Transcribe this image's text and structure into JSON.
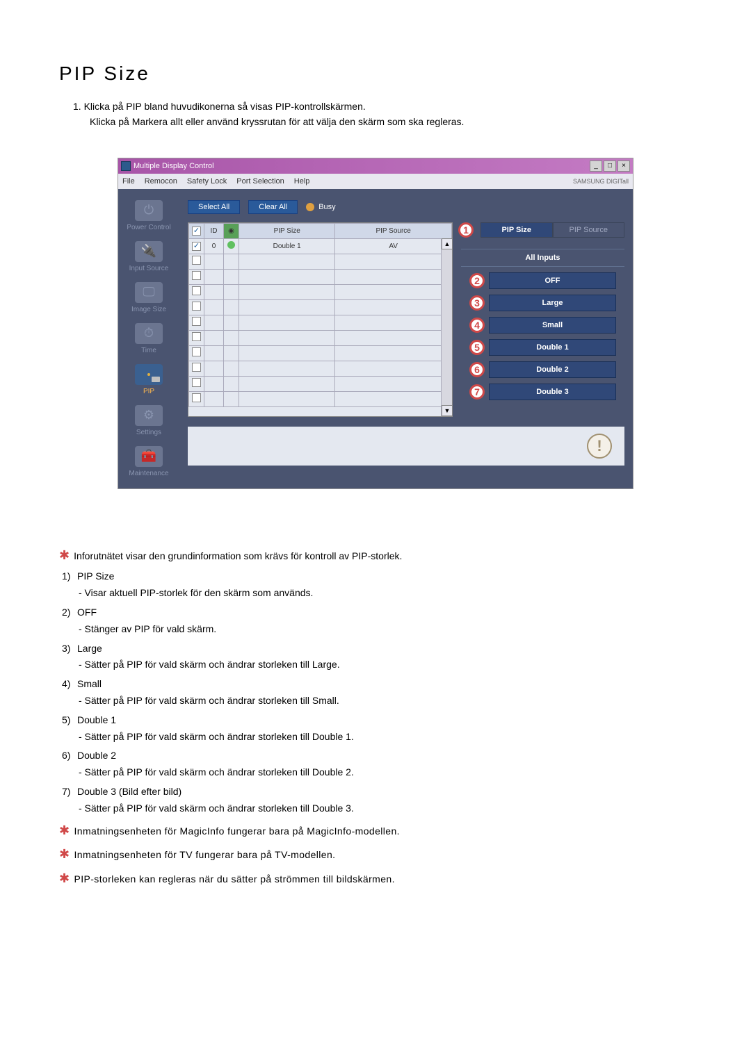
{
  "title": "PIP Size",
  "instructions": {
    "num": "1.",
    "line1": "Klicka på PIP bland huvudikonerna så visas PIP-kontrollskärmen.",
    "line2": "Klicka på Markera allt eller använd kryssrutan för att välja den skärm som ska regleras."
  },
  "app": {
    "title": "Multiple Display Control",
    "menu": {
      "file": "File",
      "remocon": "Remocon",
      "safety": "Safety Lock",
      "port": "Port Selection",
      "help": "Help"
    },
    "brand": "SAMSUNG DIGITall",
    "sidebar": {
      "power": "Power Control",
      "input": "Input Source",
      "image": "Image Size",
      "time": "Time",
      "pip": "PIP",
      "settings": "Settings",
      "maint": "Maintenance"
    },
    "toolbar": {
      "select_all": "Select All",
      "clear_all": "Clear All",
      "busy": "Busy"
    },
    "grid": {
      "cols": {
        "id": "ID",
        "size": "PIP Size",
        "source": "PIP Source"
      },
      "row0": {
        "id": "0",
        "size": "Double 1",
        "source": "AV"
      }
    },
    "tabs": {
      "pip_size": "PIP Size",
      "pip_source": "PIP Source",
      "marker": "1"
    },
    "all_inputs": "All Inputs",
    "options": {
      "off": {
        "marker": "2",
        "label": "OFF"
      },
      "large": {
        "marker": "3",
        "label": "Large"
      },
      "small": {
        "marker": "4",
        "label": "Small"
      },
      "db1": {
        "marker": "5",
        "label": "Double 1"
      },
      "db2": {
        "marker": "6",
        "label": "Double 2"
      },
      "db3": {
        "marker": "7",
        "label": "Double 3"
      }
    }
  },
  "notes": {
    "n0": "Inforutnätet visar den grundinformation som krävs för kontroll av PIP-storlek.",
    "d1": {
      "h": "PIP Size",
      "t": "- Visar aktuell PIP-storlek för den skärm som används."
    },
    "d2": {
      "h": "OFF",
      "t": "- Stänger av PIP för vald skärm."
    },
    "d3": {
      "h": "Large",
      "t": "- Sätter på PIP för vald skärm och ändrar storleken till Large."
    },
    "d4": {
      "h": "Small",
      "t": "- Sätter på PIP för vald skärm och ändrar storleken till Small."
    },
    "d5": {
      "h": "Double 1",
      "t": "- Sätter på PIP för vald skärm och ändrar storleken till Double 1."
    },
    "d6": {
      "h": "Double 2",
      "t": "- Sätter på PIP för vald skärm och ändrar storleken till Double 2."
    },
    "d7": {
      "h": "Double 3 (Bild efter bild)",
      "t": "- Sätter på PIP för vald skärm och ändrar storleken till Double 3."
    },
    "n1": "Inmatningsenheten för MagicInfo fungerar bara på MagicInfo-modellen.",
    "n2": "Inmatningsenheten för TV fungerar bara på TV-modellen.",
    "n3": "PIP-storleken kan regleras när du sätter på strömmen till bildskärmen.",
    "nums": {
      "n1": "1)",
      "n2": "2)",
      "n3": "3)",
      "n4": "4)",
      "n5": "5)",
      "n6": "6)",
      "n7": "7)"
    }
  }
}
